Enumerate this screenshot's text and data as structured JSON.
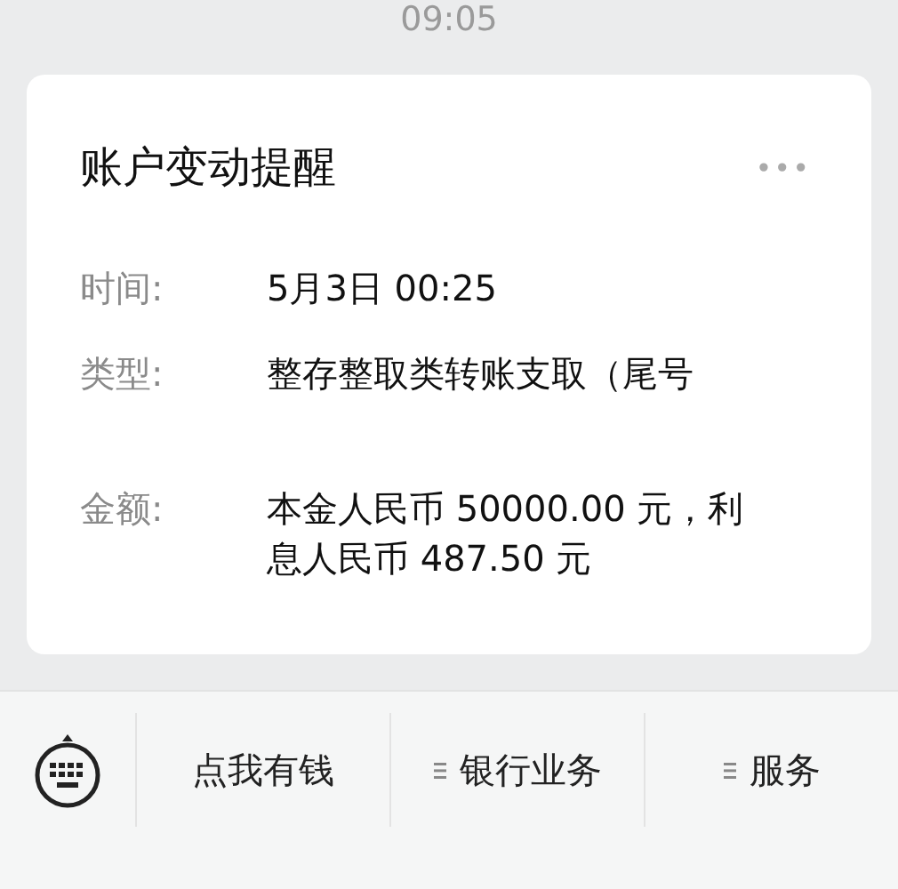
{
  "status_time": "09:05",
  "card": {
    "title": "账户变动提醒",
    "more_icon": "•••",
    "fields": [
      {
        "label": "时间:",
        "lines": [
          "5月3日 00:25"
        ]
      },
      {
        "label": "类型:",
        "lines": [
          "整存整取类转账支取（尾号"
        ]
      },
      {
        "label": "金额:",
        "lines": [
          "本金人民币 50000.00 元，利",
          "息人民币 487.50 元"
        ]
      }
    ]
  },
  "menu_bar": {
    "items": [
      {
        "label": "点我有钱",
        "has_submenu": false
      },
      {
        "label": "银行业务",
        "has_submenu": true
      },
      {
        "label": "服务",
        "has_submenu": true
      }
    ]
  }
}
